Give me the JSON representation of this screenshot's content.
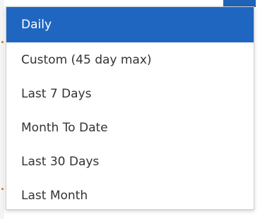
{
  "dropdown": {
    "selected_index": 0,
    "options": [
      {
        "label": "Daily"
      },
      {
        "label": "Custom (45 day max)"
      },
      {
        "label": "Last 7 Days"
      },
      {
        "label": "Month To Date"
      },
      {
        "label": "Last 30 Days"
      },
      {
        "label": "Last Month"
      }
    ]
  },
  "colors": {
    "selected_bg": "#1f66c1",
    "selected_text": "#ffffff",
    "option_text": "#333333",
    "border": "#cfcfcf"
  }
}
